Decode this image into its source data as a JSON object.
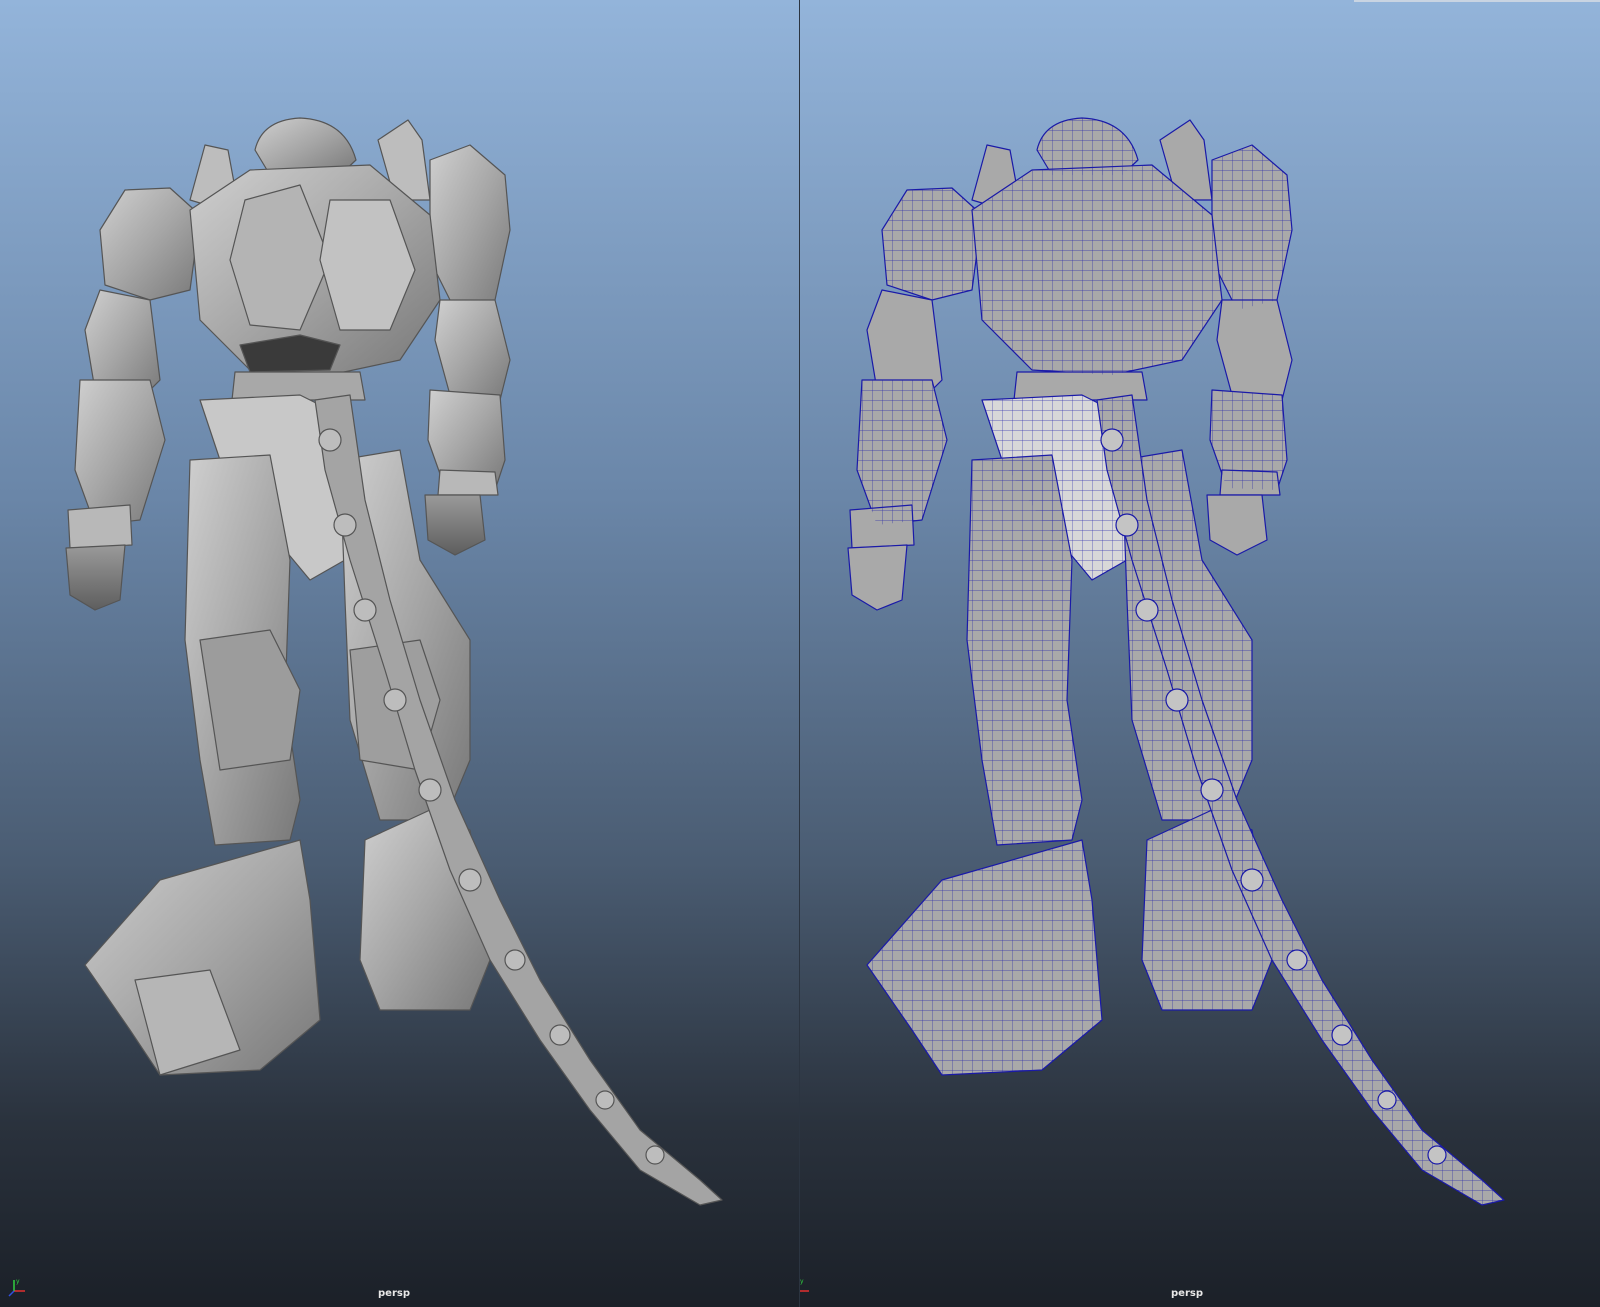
{
  "panes": [
    {
      "camera": "persp",
      "shading": "smooth-shaded",
      "icon": "axis-gizmo-icon"
    },
    {
      "camera": "persp",
      "shading": "wireframe-on-shaded",
      "icon": "axis-gizmo-icon"
    }
  ],
  "colors": {
    "background_top": "#93b4da",
    "background_bottom": "#1b2028",
    "model_fill": "#a9a9a9",
    "model_shadow": "#6f6f6f",
    "model_highlight": "#d4d4d4",
    "wireframe": "#1a1aa8",
    "axis_x": "#e03030",
    "axis_y": "#30d040",
    "axis_z": "#3050e0"
  }
}
